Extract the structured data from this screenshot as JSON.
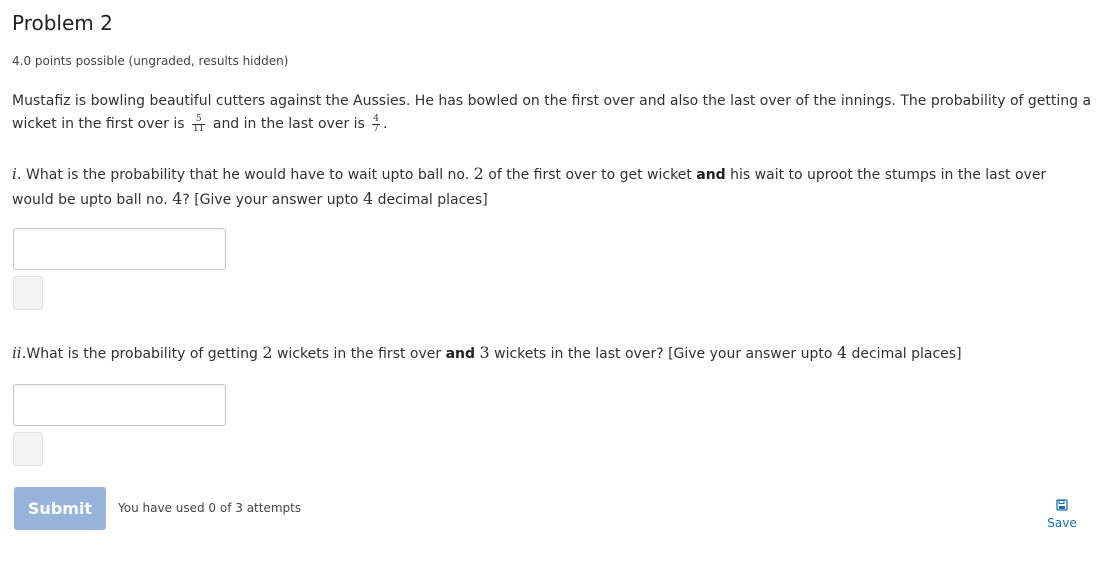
{
  "problem": {
    "title": "Problem 2",
    "points": "4.0 points possible (ungraded, results hidden)"
  },
  "intro": {
    "line1": "Mustafiz is bowling beautiful cutters against the Aussies. He has bowled on the first over and also the last over of the innings. The probability of getting a",
    "line2_a": "wicket in the first over is",
    "frac1_num": "5",
    "frac1_den": "11",
    "line2_b": "and in the last over is",
    "frac2_num": "4",
    "frac2_den": "7",
    "line2_end": "."
  },
  "q1": {
    "label": "i.",
    "text_a": "What is the probability that he would have to wait upto ball no.",
    "num1": "2",
    "text_b": "of the first over to get wicket",
    "bold": "and",
    "text_c": "his wait to uproot the stumps in the last over",
    "line2_a": "would be upto ball no.",
    "num2": "4",
    "line2_b": "? [Give your answer upto",
    "num3": "4",
    "line2_c": "decimal places]",
    "answer_value": ""
  },
  "q2": {
    "label": "ii.",
    "text_a": "What is the probability of getting",
    "num1": "2",
    "text_b": "wickets in the first over",
    "bold": "and",
    "num2": "3",
    "text_c": "wickets in the last over? [Give your answer upto",
    "num3": "4",
    "text_d": "decimal places]",
    "answer_value": ""
  },
  "actions": {
    "submit_label": "Submit",
    "attempts_text": "You have used 0 of 3 attempts",
    "save_label": "Save",
    "save_icon": "floppy-disk-icon"
  },
  "colors": {
    "submit_bg": "#98b3d9",
    "link_blue": "#1a6fb4"
  }
}
